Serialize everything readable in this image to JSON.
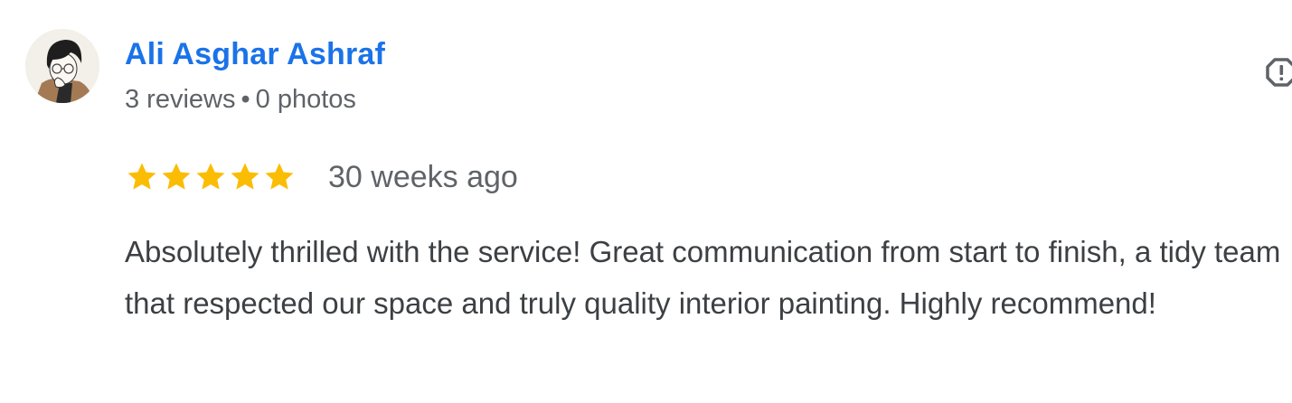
{
  "review": {
    "author": {
      "name": "Ali Asghar Ashraf",
      "reviews": "3 reviews",
      "separator": "•",
      "photos": "0 photos"
    },
    "rating": 5,
    "rating_max": 5,
    "age": "30 weeks ago",
    "text": "Absolutely thrilled with the service! Great communication from start to finish, a tidy team that respected our space and truly quality interior painting. Highly recommend!"
  },
  "icons": {
    "star": "star-icon",
    "flag": "report-flag-icon",
    "avatar": "user-avatar"
  },
  "colors": {
    "author_link": "#1a73e8",
    "meta_text": "#5f6368",
    "body_text": "#3c4043",
    "star": "#fbbc04"
  }
}
